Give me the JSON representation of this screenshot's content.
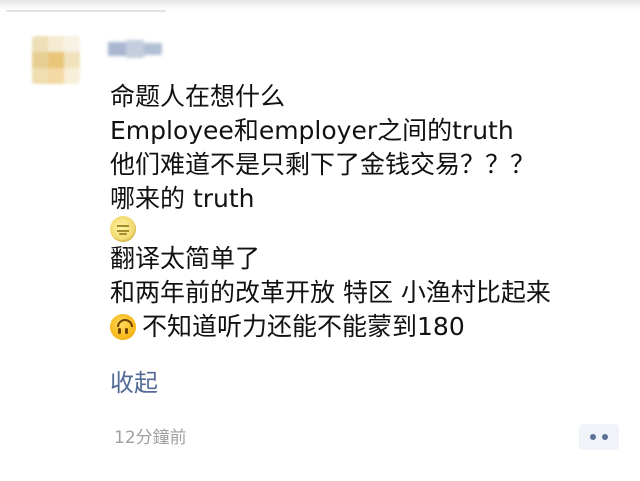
{
  "post": {
    "lines": [
      "命题人在想什么",
      "Employee和employer之间的truth",
      "他们难道不是只剩下了金钱交易？？？",
      "哪来的 truth",
      "",
      "翻译太简单了",
      "和两年前的改革开放 特区 小渔村比起来",
      "不知道听力还能不能蒙到180"
    ],
    "emoji_line_index": 4,
    "emoji_moon": "moon-emoji-icon",
    "emoji_upside": "upside-down-face-icon"
  },
  "actions": {
    "collapse_label": "收起",
    "timestamp": "12分鐘前",
    "more_icon": "more-dots-icon"
  },
  "colors": {
    "text": "#111111",
    "link": "#536b96",
    "meta": "#a0a0a0",
    "more_button_bg": "#f0f3f8",
    "more_dots": "#5c7396"
  }
}
